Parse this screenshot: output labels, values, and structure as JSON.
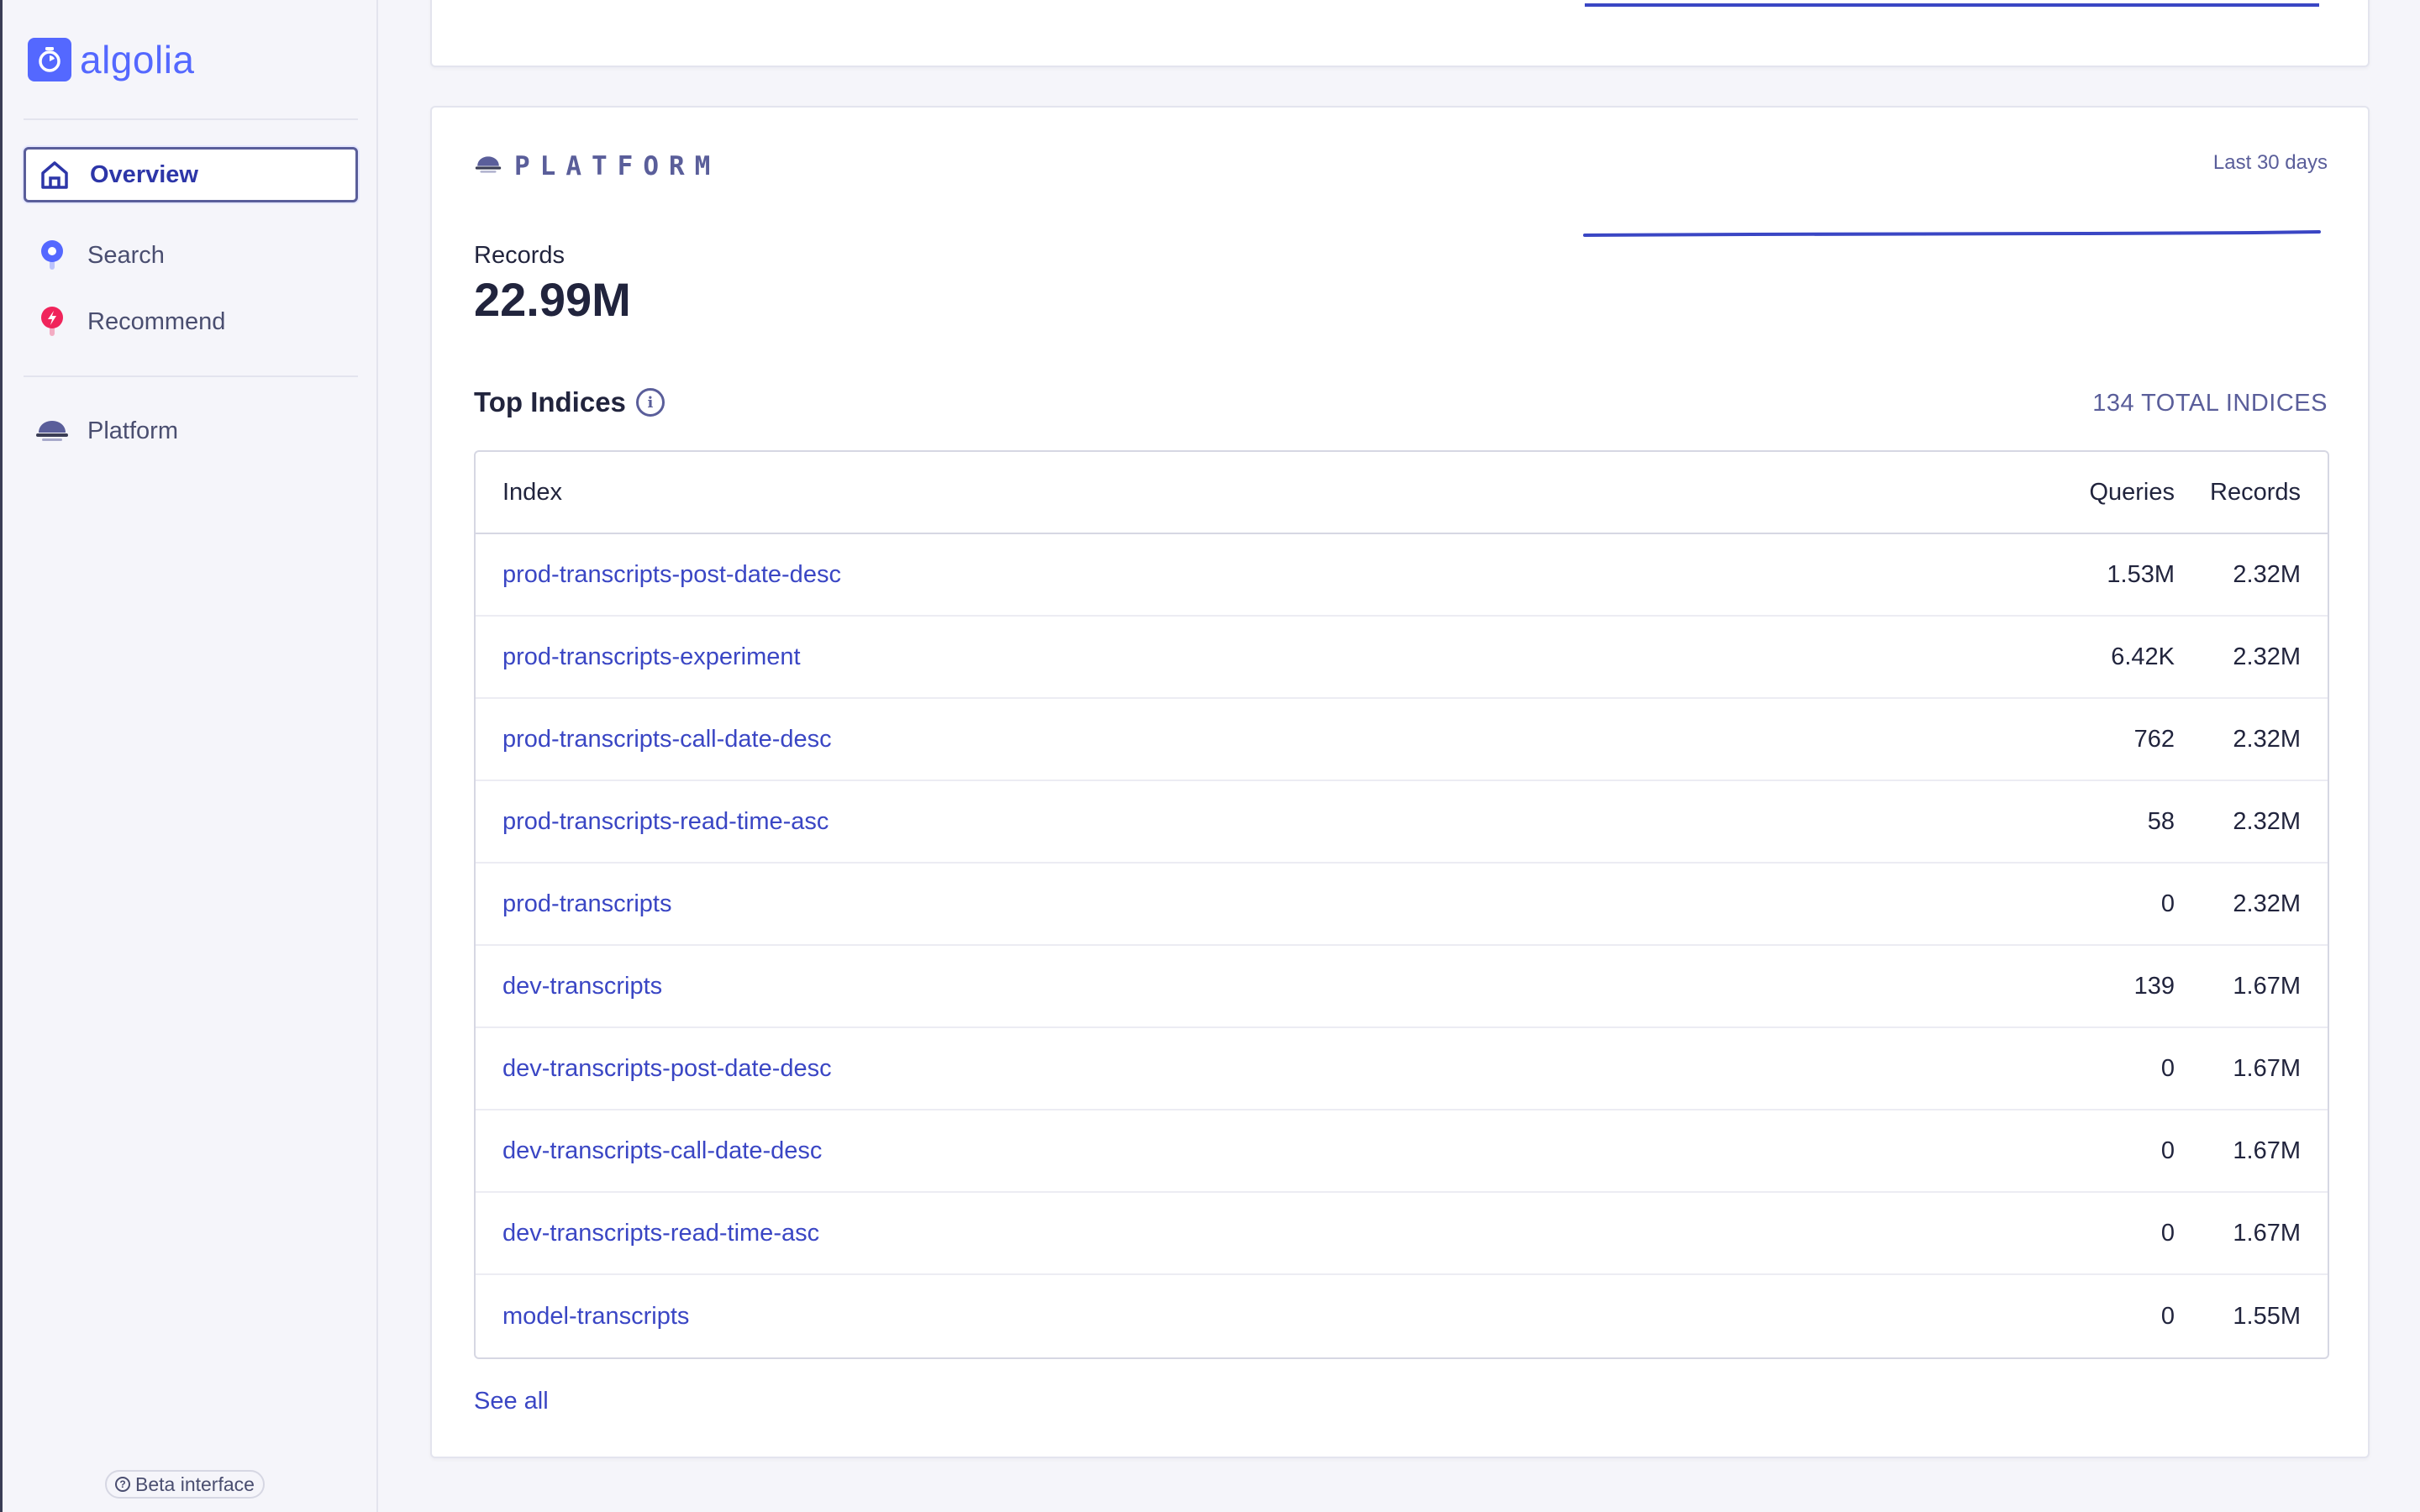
{
  "brand": {
    "name": "algolia",
    "color": "#5468ff"
  },
  "sidebar": {
    "items": [
      {
        "label": "Overview",
        "icon": "home-icon",
        "active": true
      },
      {
        "label": "Search",
        "icon": "search-icon",
        "active": false
      },
      {
        "label": "Recommend",
        "icon": "recommend-icon",
        "active": false
      }
    ],
    "platform": {
      "label": "Platform",
      "icon": "platform-icon"
    },
    "beta_label": "Beta interface"
  },
  "platform_card": {
    "title": "PLATFORM",
    "range": "Last 30 days",
    "records_label": "Records",
    "records_value": "22.99M",
    "top_indices_title": "Top Indices",
    "total_indices": "134 TOTAL INDICES",
    "table": {
      "headers": {
        "index": "Index",
        "queries": "Queries",
        "records": "Records"
      },
      "rows": [
        {
          "index": "prod-transcripts-post-date-desc",
          "queries": "1.53M",
          "records": "2.32M"
        },
        {
          "index": "prod-transcripts-experiment",
          "queries": "6.42K",
          "records": "2.32M"
        },
        {
          "index": "prod-transcripts-call-date-desc",
          "queries": "762",
          "records": "2.32M"
        },
        {
          "index": "prod-transcripts-read-time-asc",
          "queries": "58",
          "records": "2.32M"
        },
        {
          "index": "prod-transcripts",
          "queries": "0",
          "records": "2.32M"
        },
        {
          "index": "dev-transcripts",
          "queries": "139",
          "records": "1.67M"
        },
        {
          "index": "dev-transcripts-post-date-desc",
          "queries": "0",
          "records": "1.67M"
        },
        {
          "index": "dev-transcripts-call-date-desc",
          "queries": "0",
          "records": "1.67M"
        },
        {
          "index": "dev-transcripts-read-time-asc",
          "queries": "0",
          "records": "1.67M"
        },
        {
          "index": "model-transcripts",
          "queries": "0",
          "records": "1.55M"
        }
      ]
    },
    "see_all": "See all"
  },
  "colors": {
    "accent": "#5468ff",
    "link": "#3a46c4",
    "muted": "#5a5e9a",
    "sparkline": "#3a46c4"
  }
}
